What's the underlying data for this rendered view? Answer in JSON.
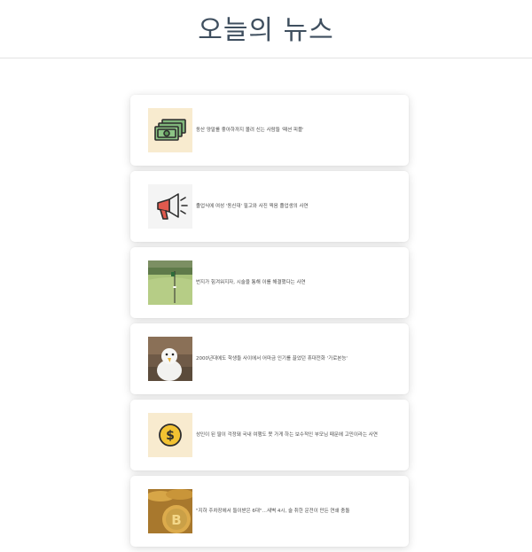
{
  "header": {
    "title": "오늘의 뉴스"
  },
  "articles": [
    {
      "headline": "동산 양말를 좋아하까지 몰려 신는 사람들 '패션 피플'",
      "thumbnail_icon": "money-icon",
      "thumbnail_bg": "#f8ebcf"
    },
    {
      "headline": "졸업식에 여성 '동신대' 필고와 사진 찍음 졸업생의 사연",
      "thumbnail_icon": "megaphone-icon",
      "thumbnail_bg": "#f4f4f4"
    },
    {
      "headline": "번지가 힘겨워지자, 시술을 통해 이를 해결했다는 사연",
      "thumbnail_icon": "golf-green-photo",
      "thumbnail_bg": "#a9c27a"
    },
    {
      "headline": "2000년대에도 학생들 사이에서 어마금 인기를 끌었던 휴대전화 '가로본능'",
      "thumbnail_icon": "seagull-photo",
      "thumbnail_bg": "#6f5a47"
    },
    {
      "headline": "성인이 된 딸이 걱정돼 국내 여행도 못 가게 하는 보수적인 부모님 때문에 고민이라는 사연",
      "thumbnail_icon": "dollar-coin-icon",
      "thumbnail_bg": "#f8ebcf"
    },
    {
      "headline": "\"지하 주차장에서 들이받은 6대\"…새벽 4시, 술 취한 운전이 만든 연쇄 충돌",
      "thumbnail_icon": "bitcoin-photo",
      "thumbnail_bg": "#c8963e"
    }
  ]
}
